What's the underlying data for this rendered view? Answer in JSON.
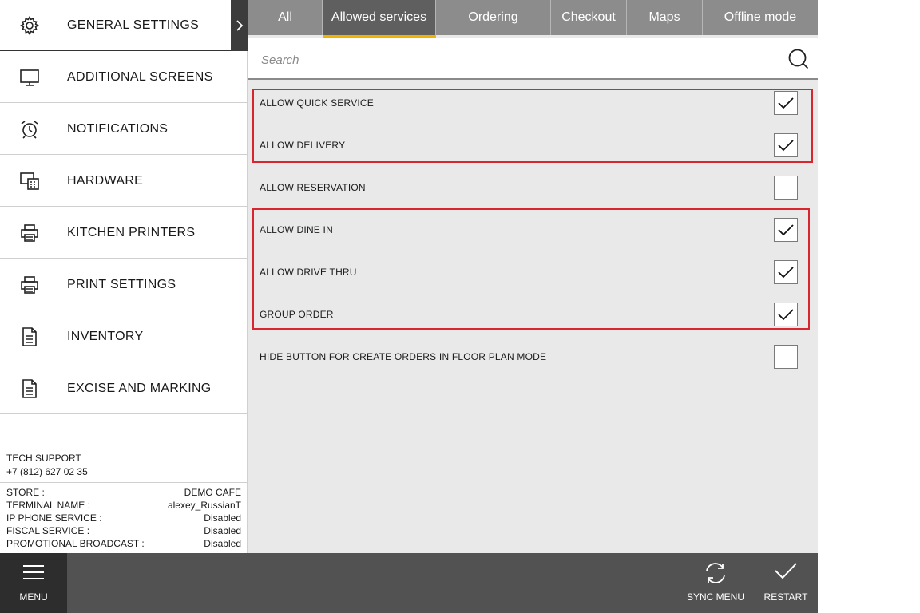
{
  "sidebar": {
    "items": [
      {
        "label": "GENERAL SETTINGS",
        "icon": "gear-icon"
      },
      {
        "label": "ADDITIONAL SCREENS",
        "icon": "monitor-icon"
      },
      {
        "label": "NOTIFICATIONS",
        "icon": "alarm-clock-icon"
      },
      {
        "label": "HARDWARE",
        "icon": "pos-terminal-icon"
      },
      {
        "label": "KITCHEN PRINTERS",
        "icon": "printer-icon"
      },
      {
        "label": "PRINT SETTINGS",
        "icon": "printer-icon"
      },
      {
        "label": "INVENTORY",
        "icon": "document-icon"
      },
      {
        "label": "EXCISE AND MARKING",
        "icon": "document-icon"
      }
    ],
    "tech_support": {
      "label": "TECH SUPPORT",
      "phone": "+7 (812) 627 02 35"
    },
    "info": [
      {
        "key": "STORE :",
        "value": "DEMO CAFE"
      },
      {
        "key": "TERMINAL NAME :",
        "value": "alexey_RussianT"
      },
      {
        "key": "IP PHONE SERVICE :",
        "value": "Disabled"
      },
      {
        "key": "FISCAL SERVICE :",
        "value": "Disabled"
      },
      {
        "key": "PROMOTIONAL BROADCAST :",
        "value": "Disabled"
      }
    ]
  },
  "tabs": [
    {
      "label": "All",
      "active": false
    },
    {
      "label": "Allowed services",
      "active": true
    },
    {
      "label": "Ordering",
      "active": false
    },
    {
      "label": "Checkout",
      "active": false
    },
    {
      "label": "Maps",
      "active": false
    },
    {
      "label": "Offline mode",
      "active": false
    }
  ],
  "search": {
    "placeholder": "Search",
    "value": ""
  },
  "options": [
    {
      "label": "ALLOW QUICK SERVICE",
      "checked": true
    },
    {
      "label": "ALLOW DELIVERY",
      "checked": true
    },
    {
      "label": "ALLOW RESERVATION",
      "checked": false
    },
    {
      "label": "ALLOW DINE IN",
      "checked": true
    },
    {
      "label": "ALLOW DRIVE THRU",
      "checked": true
    },
    {
      "label": "GROUP ORDER",
      "checked": true
    },
    {
      "label": "HIDE BUTTON FOR CREATE ORDERS IN FLOOR PLAN MODE",
      "checked": false
    }
  ],
  "bottombar": {
    "menu_label": "MENU",
    "sync_label": "SYNC MENU",
    "restart_label": "RESTART"
  },
  "colors": {
    "accent": "#f0b400",
    "highlight": "#d9262e",
    "tab_bg": "#8c8c8c",
    "bottombar_bg": "#525252"
  }
}
